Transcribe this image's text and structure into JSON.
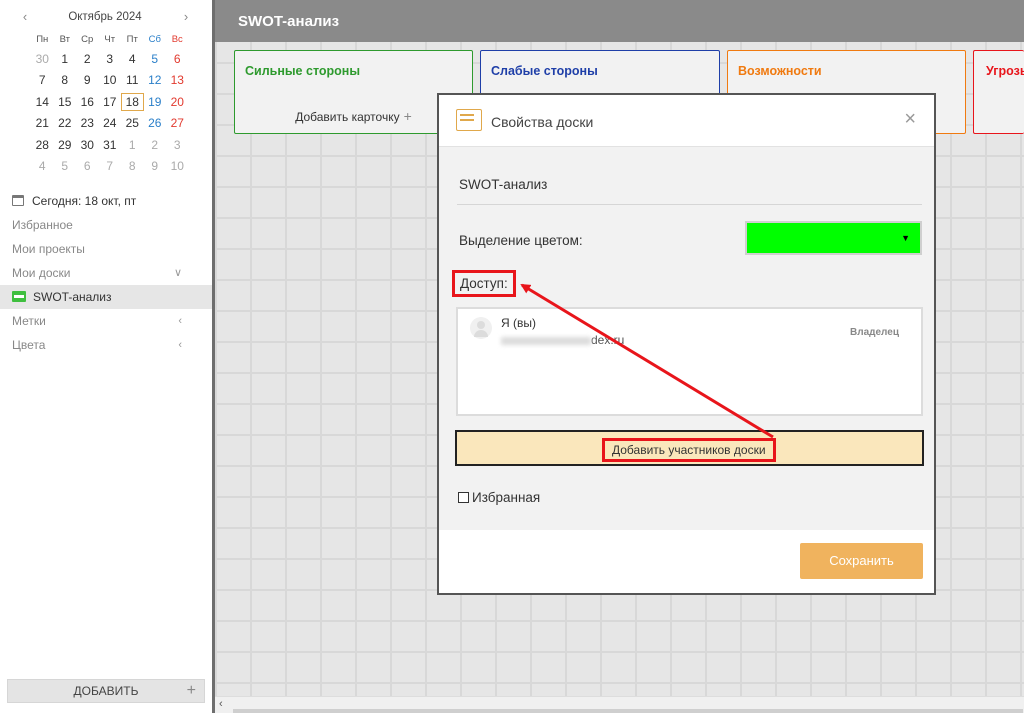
{
  "calendar": {
    "title": "Октябрь 2024",
    "prev_icon": "‹",
    "next_icon": "›",
    "weekdays": [
      "Пн",
      "Вт",
      "Ср",
      "Чт",
      "Пт",
      "Сб",
      "Вс"
    ],
    "weeks": [
      [
        "30",
        "1",
        "2",
        "3",
        "4",
        "5",
        "6"
      ],
      [
        "7",
        "8",
        "9",
        "10",
        "11",
        "12",
        "13"
      ],
      [
        "14",
        "15",
        "16",
        "17",
        "18",
        "19",
        "20"
      ],
      [
        "21",
        "22",
        "23",
        "24",
        "25",
        "26",
        "27"
      ],
      [
        "28",
        "29",
        "30",
        "31",
        "1",
        "2",
        "3"
      ],
      [
        "4",
        "5",
        "6",
        "7",
        "8",
        "9",
        "10"
      ]
    ],
    "today": "18"
  },
  "sidebar": {
    "today_label": "Сегодня: 18 окт, пт",
    "items": [
      {
        "label": "Избранное"
      },
      {
        "label": "Мои проекты"
      },
      {
        "label": "Мои доски",
        "chevron": "∨"
      },
      {
        "label": "SWOT-анализ"
      },
      {
        "label": "Метки",
        "chevron": "‹"
      },
      {
        "label": "Цвета",
        "chevron": "‹"
      }
    ],
    "add_button": "ДОБАВИТЬ",
    "add_icon": "+"
  },
  "board": {
    "title": "SWOT-анализ",
    "columns": [
      {
        "title": "Сильные стороны",
        "color": "#2e9a2e",
        "add_card": "Добавить карточку"
      },
      {
        "title": "Слабые стороны",
        "color": "#1f3fa8"
      },
      {
        "title": "Возможности",
        "color": "#f07a10"
      },
      {
        "title": "Угрозы",
        "color": "#e8151b"
      }
    ],
    "plus_icon": "+",
    "scroll_arrow": "‹"
  },
  "modal": {
    "title": "Свойства доски",
    "close_icon": "×",
    "board_name": "SWOT-анализ",
    "color_label": "Выделение цветом:",
    "color_value": "#00ff00",
    "color_caret": "▼",
    "access_label": "Доступ:",
    "members": [
      {
        "name": "Я (вы)",
        "email_suffix": "dex.ru",
        "role": "Владелец"
      }
    ],
    "add_members_button": "Добавить участников доски",
    "favorite_label": "Избранная",
    "favorite_checked": false,
    "save_button": "Сохранить"
  },
  "colors": {
    "highlight_red": "#e8151b",
    "save_orange": "#f0b35e",
    "add_members_bg": "#fae7bc"
  }
}
